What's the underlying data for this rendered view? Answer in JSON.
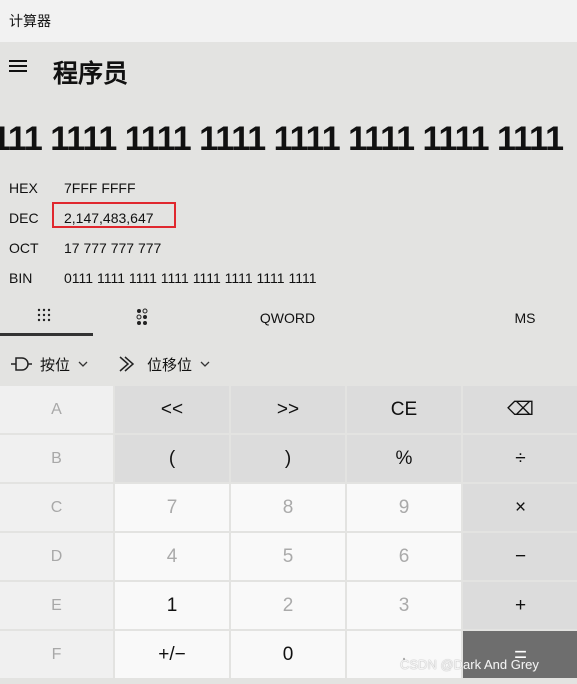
{
  "app": {
    "title": "计算器"
  },
  "header": {
    "mode": "程序员"
  },
  "display": {
    "value": "111 1111 1111 1111 1111 1111 1111 1111"
  },
  "radix": [
    {
      "label": "HEX",
      "value": "7FFF FFFF"
    },
    {
      "label": "DEC",
      "value": "2,147,483,647"
    },
    {
      "label": "OCT",
      "value": "17 777 777 777"
    },
    {
      "label": "BIN",
      "value": "0111 1111 1111 1111 1111 1111 1111 1111"
    }
  ],
  "tabs": {
    "word_size": "QWORD",
    "memory": "MS"
  },
  "ops": {
    "bitwise": "按位",
    "bitshift": "位移位"
  },
  "keys": [
    [
      "A",
      "<<",
      ">>",
      "CE",
      "⌫"
    ],
    [
      "B",
      "(",
      ")",
      "%",
      "÷"
    ],
    [
      "C",
      "7",
      "8",
      "9",
      "×"
    ],
    [
      "D",
      "4",
      "5",
      "6",
      "−"
    ],
    [
      "E",
      "1",
      "2",
      "3",
      "+"
    ],
    [
      "F",
      "+/−",
      "0",
      ".",
      "="
    ]
  ],
  "watermark": "CSDN @Dark And Grey",
  "colors": {
    "highlight": "#e0282e",
    "equals_bg": "#6e6e6e"
  }
}
